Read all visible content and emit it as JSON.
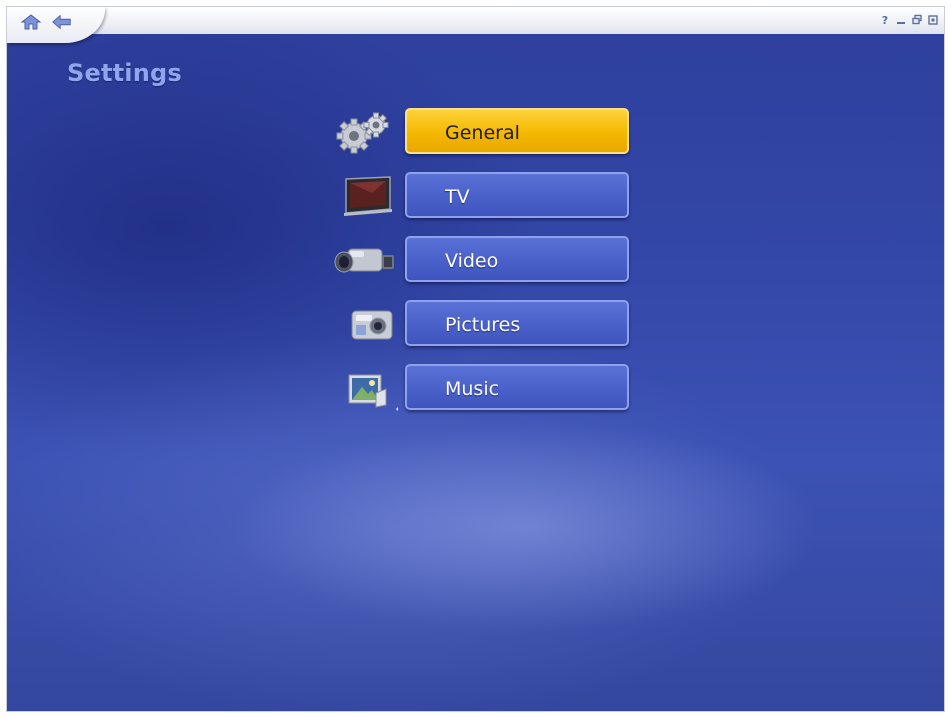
{
  "window": {
    "controls": [
      {
        "name": "help",
        "glyph": "?"
      },
      {
        "name": "minimize",
        "glyph": "▁"
      },
      {
        "name": "restore",
        "glyph": "◫"
      },
      {
        "name": "close",
        "glyph": "▣"
      }
    ]
  },
  "nav": {
    "home_icon": "home-icon",
    "back_icon": "back-arrow-icon"
  },
  "page": {
    "title": "Settings"
  },
  "menu": {
    "selected_index": 0,
    "accent_selected": "#f4b800",
    "accent_normal": "#4a62ca",
    "items": [
      {
        "label": "General",
        "icon": "gears-icon"
      },
      {
        "label": "TV",
        "icon": "tv-icon"
      },
      {
        "label": "Video",
        "icon": "video-camera-icon"
      },
      {
        "label": "Pictures",
        "icon": "photo-camera-icon"
      },
      {
        "label": "Music",
        "icon": "music-picture-icon"
      }
    ]
  }
}
